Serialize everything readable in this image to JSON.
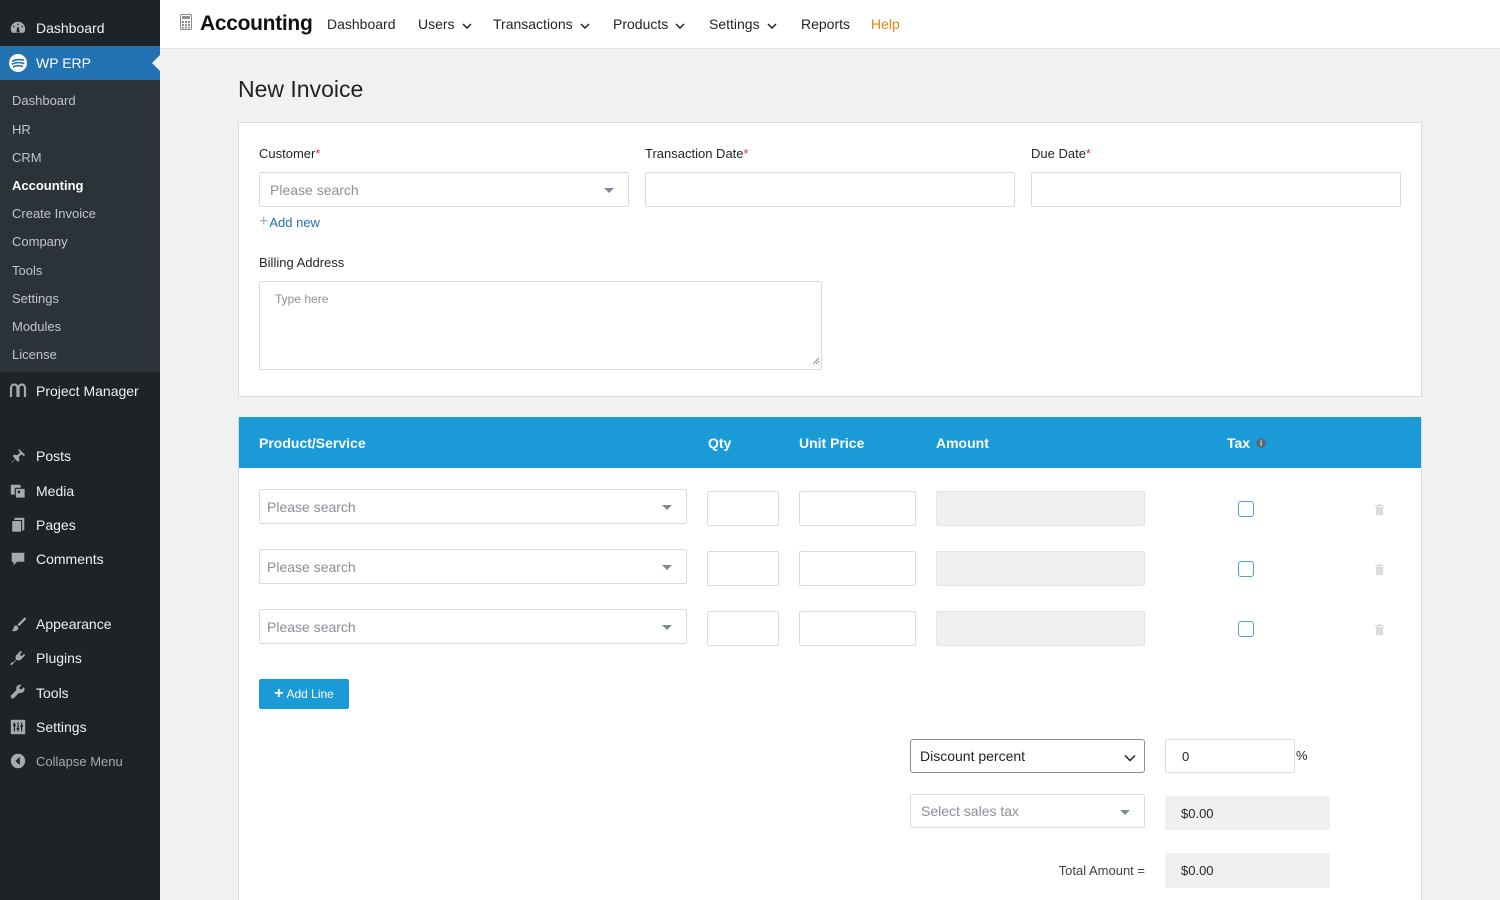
{
  "sidebar": {
    "top_items": [
      {
        "label": "Dashboard",
        "icon": "dashboard-icon"
      },
      {
        "label": "WP ERP",
        "icon": "wp-erp-icon",
        "active": true
      }
    ],
    "submenu": [
      {
        "label": "Dashboard"
      },
      {
        "label": "HR"
      },
      {
        "label": "CRM"
      },
      {
        "label": "Accounting",
        "current": true
      },
      {
        "label": "Create Invoice"
      },
      {
        "label": "Company"
      },
      {
        "label": "Tools"
      },
      {
        "label": "Settings"
      },
      {
        "label": "Modules"
      },
      {
        "label": "License"
      }
    ],
    "bottom_items": [
      {
        "label": "Project Manager",
        "icon": "project-manager-icon"
      },
      {
        "label": "Posts",
        "icon": "pin-icon"
      },
      {
        "label": "Media",
        "icon": "media-icon"
      },
      {
        "label": "Pages",
        "icon": "pages-icon"
      },
      {
        "label": "Comments",
        "icon": "comment-icon"
      },
      {
        "label": "Appearance",
        "icon": "paintbrush-icon"
      },
      {
        "label": "Plugins",
        "icon": "plugin-icon"
      },
      {
        "label": "Tools",
        "icon": "wrench-icon"
      },
      {
        "label": "Settings",
        "icon": "settings-icon"
      },
      {
        "label": "Collapse Menu",
        "icon": "collapse-icon"
      }
    ]
  },
  "topnav": {
    "brand": "Accounting",
    "items": [
      {
        "label": "Dashboard",
        "dropdown": false
      },
      {
        "label": "Users",
        "dropdown": true
      },
      {
        "label": "Transactions",
        "dropdown": true
      },
      {
        "label": "Products",
        "dropdown": true
      },
      {
        "label": "Settings",
        "dropdown": true
      },
      {
        "label": "Reports",
        "dropdown": false
      },
      {
        "label": "Help",
        "dropdown": false
      }
    ],
    "help_color": "#e6860b"
  },
  "page": {
    "title": "New Invoice"
  },
  "form": {
    "customer_label": "Customer",
    "customer_placeholder": "Please search",
    "transaction_date_label": "Transaction Date",
    "transaction_date_value": "",
    "due_date_label": "Due Date",
    "due_date_value": "",
    "required_mark": "*",
    "add_new": "Add new",
    "billing_address_label": "Billing Address",
    "billing_address_placeholder": "Type here"
  },
  "table": {
    "headers": {
      "product": "Product/Service",
      "qty": "Qty",
      "unit_price": "Unit Price",
      "amount": "Amount",
      "tax": "Tax"
    },
    "header_color": "#1a9ad6",
    "rows": [
      {
        "product_placeholder": "Please search",
        "qty": "",
        "unit_price": "",
        "amount": "",
        "tax": false
      },
      {
        "product_placeholder": "Please search",
        "qty": "",
        "unit_price": "",
        "amount": "",
        "tax": false
      },
      {
        "product_placeholder": "Please search",
        "qty": "",
        "unit_price": "",
        "amount": "",
        "tax": false
      }
    ],
    "add_line": "Add Line"
  },
  "summary": {
    "discount_type": "Discount percent",
    "discount_value": "0",
    "discount_unit": "%",
    "sales_tax_placeholder": "Select sales tax",
    "sales_tax_value": "$0.00",
    "total_label": "Total Amount =",
    "total_value": "$0.00"
  }
}
